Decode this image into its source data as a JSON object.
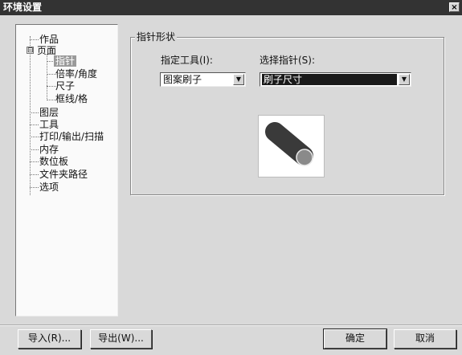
{
  "window": {
    "title": "环境设置",
    "close_label": "×"
  },
  "tree": {
    "items": [
      {
        "label": "作品"
      },
      {
        "label": "页面",
        "expander": "⊟"
      },
      {
        "label": "指针"
      },
      {
        "label": "倍率/角度"
      },
      {
        "label": "尺子"
      },
      {
        "label": "框线/格"
      },
      {
        "label": "图层"
      },
      {
        "label": "工具"
      },
      {
        "label": "打印/输出/扫描"
      },
      {
        "label": "内存"
      },
      {
        "label": "数位板"
      },
      {
        "label": "文件夹路径"
      },
      {
        "label": "选项"
      }
    ]
  },
  "pointer_group": {
    "title": "指针形状",
    "tool_label": "指定工具(I):",
    "tool_value": "图案刷子",
    "pointer_label": "选择指针(S):",
    "pointer_value": "刷子尺寸"
  },
  "buttons": {
    "import": "导入(R)...",
    "export": "导出(W)...",
    "ok": "确定",
    "cancel": "取消"
  },
  "icons": {
    "dropdown_arrow": "chevron-down-icon",
    "close": "close-icon",
    "preview": "brush-size-pointer-icon"
  }
}
